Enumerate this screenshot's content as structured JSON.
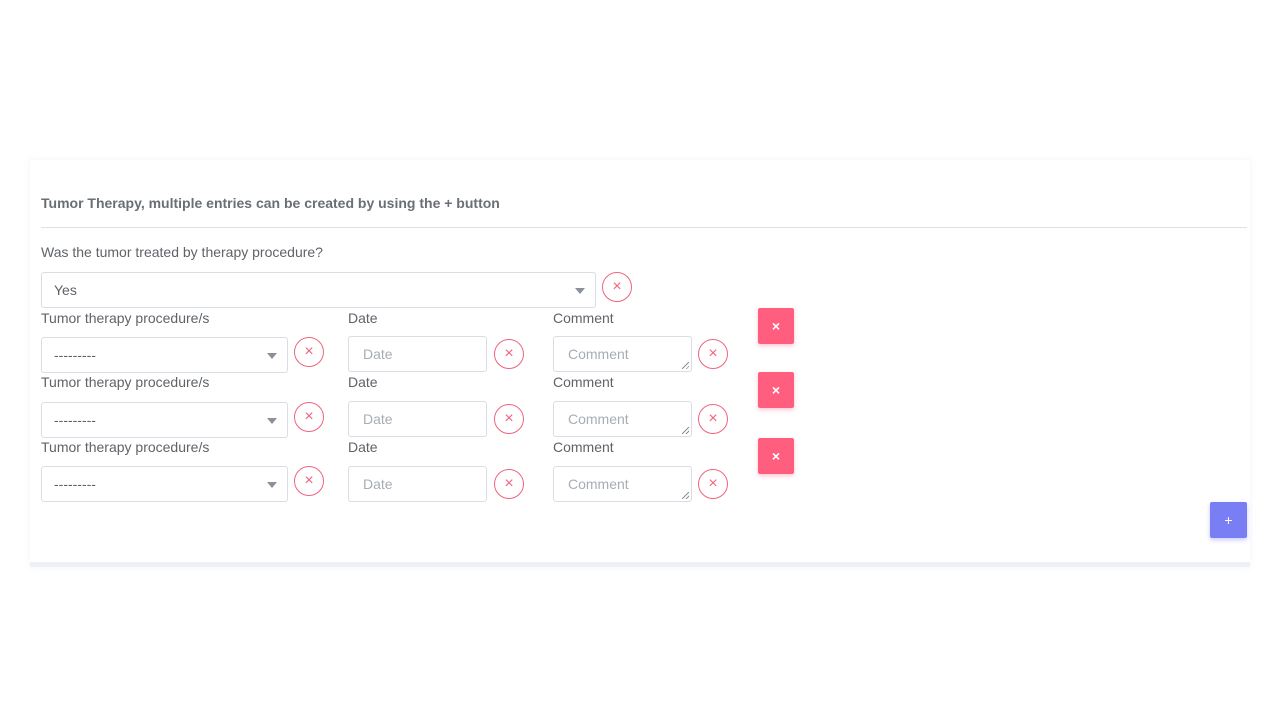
{
  "section": {
    "title": "Tumor Therapy, multiple entries can be created by using the + button",
    "question": "Was the tumor treated by therapy procedure?",
    "answer": "Yes"
  },
  "rows": [
    {
      "procedure_label": "Tumor therapy procedure/s",
      "procedure_value": "---------",
      "date_label": "Date",
      "date_placeholder": "Date",
      "comment_label": "Comment",
      "comment_placeholder": "Comment",
      "remove_label": "×"
    },
    {
      "procedure_label": "Tumor therapy procedure/s",
      "procedure_value": "---------",
      "date_label": "Date",
      "date_placeholder": "Date",
      "comment_label": "Comment",
      "comment_placeholder": "Comment",
      "remove_label": "×"
    },
    {
      "procedure_label": "Tumor therapy procedure/s",
      "procedure_value": "---------",
      "date_label": "Date",
      "date_placeholder": "Date",
      "comment_label": "Comment",
      "comment_placeholder": "Comment",
      "remove_label": "×"
    }
  ],
  "clear_icon_glyph": "×",
  "add_label": "+",
  "icons": {
    "clear": "close-circle-icon",
    "caret": "chevron-down-icon"
  },
  "colors": {
    "danger": "#ff5e7f",
    "primary": "#7a7ef5",
    "clear_outline": "#f0647d"
  }
}
